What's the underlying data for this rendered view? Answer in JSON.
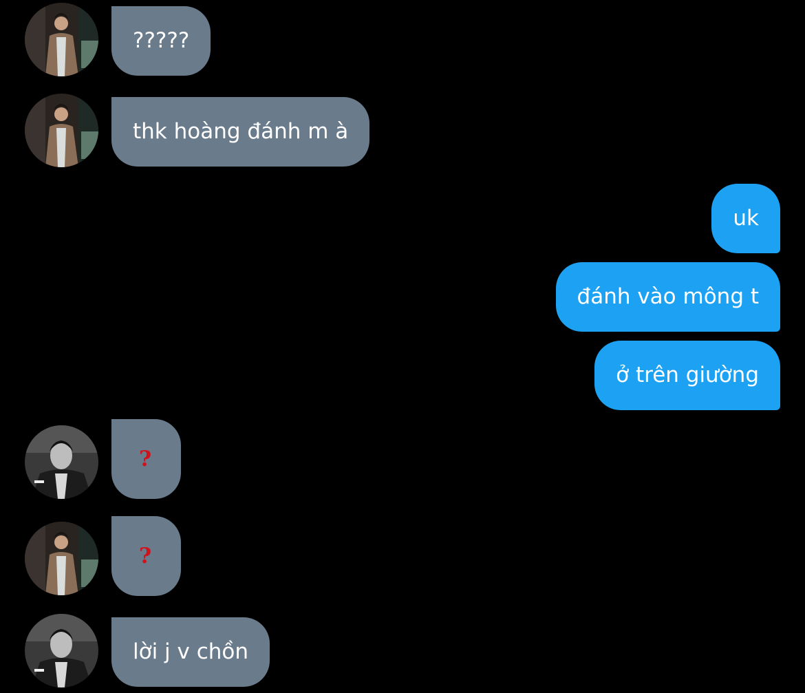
{
  "colors": {
    "background": "#000000",
    "incoming_bubble": "#6a7b8c",
    "outgoing_bubble": "#1da1f2",
    "bubble_text": "#ffffff",
    "question_mark": "#d0121b"
  },
  "messages": [
    {
      "direction": "incoming",
      "sender_avatar": "avatar-man-in-brown-suit",
      "text": "?????"
    },
    {
      "direction": "incoming",
      "sender_avatar": "avatar-man-in-brown-suit",
      "text": "thk hoàng đánh m à"
    },
    {
      "direction": "outgoing",
      "text": "uk"
    },
    {
      "direction": "outgoing",
      "text": "đánh vào mông t"
    },
    {
      "direction": "outgoing",
      "text": "ở trên giường"
    },
    {
      "direction": "incoming",
      "sender_avatar": "avatar-man-black-and-white",
      "text": "?"
    },
    {
      "direction": "incoming",
      "sender_avatar": "avatar-man-in-brown-suit",
      "text": "?"
    },
    {
      "direction": "incoming",
      "sender_avatar": "avatar-man-black-and-white",
      "text": "lời j v chồn"
    }
  ]
}
